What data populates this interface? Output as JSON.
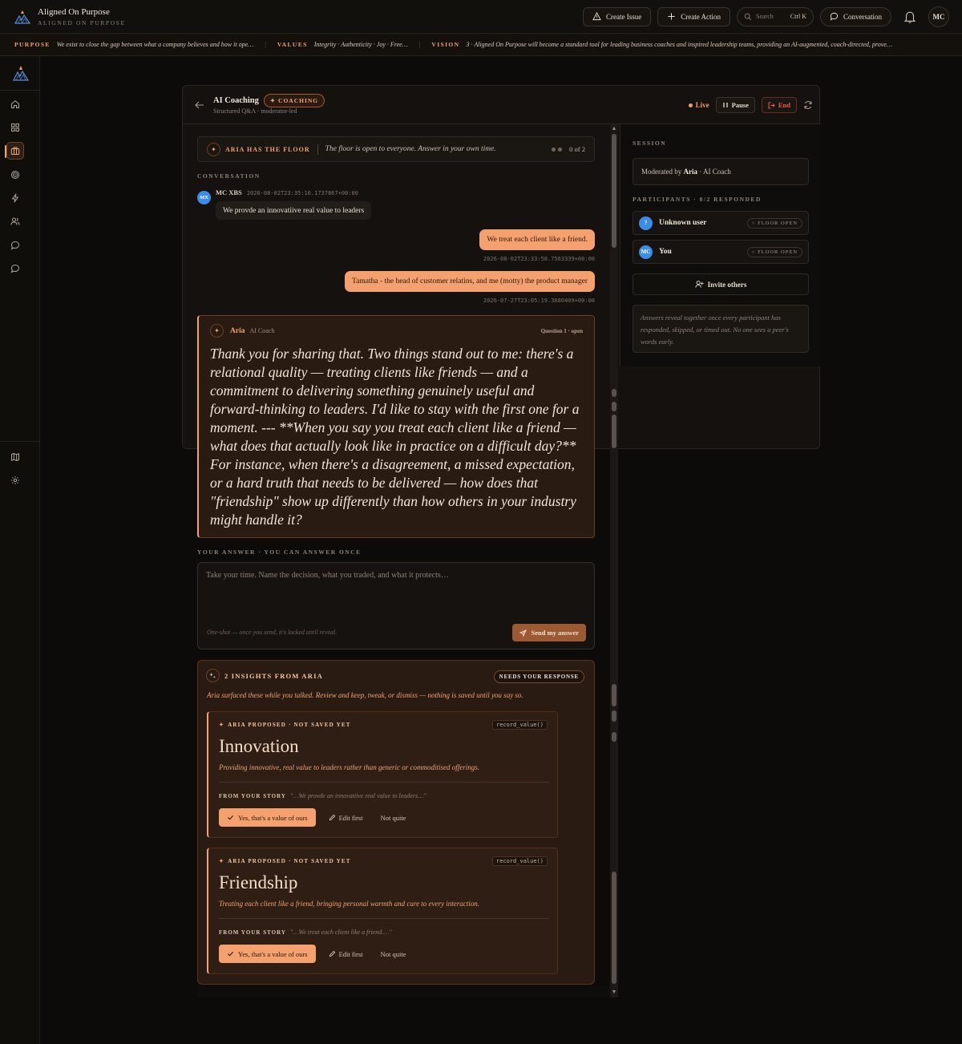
{
  "app": {
    "name": "Aligned On Purpose",
    "subtitle": "ALIGNED ON PURPOSE"
  },
  "topbar": {
    "create_issue": "Create Issue",
    "create_action": "Create Action",
    "search_placeholder": "Search",
    "search_shortcut": "Ctrl K",
    "conversation": "Conversation",
    "user_initials": "MC"
  },
  "ribbon": {
    "purpose_label": "PURPOSE",
    "purpose_text": "We exist to close the gap between what a company believes and how it ope…",
    "values_label": "VALUES",
    "values_text": "Integrity · Authenticity · Joy · Free…",
    "vision_label": "VISION",
    "vision_text": "3 · Aligned On Purpose will become a standard tool for leading business coaches and inspired leadership teams, providing an AI-augmented, coach-directed, prove…"
  },
  "session_header": {
    "title": "AI Coaching",
    "badge": "✦ COACHING",
    "subtitle": "Structured Q&A · moderator-led",
    "live": "Live",
    "pause": "Pause",
    "end": "End"
  },
  "floor": {
    "label": "ARIA HAS THE FLOOR",
    "text": "The floor is open to everyone. Answer in your own time.",
    "count": "0 of 2"
  },
  "conversation": {
    "label": "CONVERSATION",
    "messages": [
      {
        "initials": "MX",
        "author": "MC XBS",
        "timestamp": "2026-08-02T23:35:10.1737867+00:00",
        "text": "We provde an innovatiive real value to leaders"
      },
      {
        "text": "We treat each client like a friend.",
        "timestamp": "2026-08-02T23:33:58.7563339+00:00"
      },
      {
        "text": "Tamatha - the head of customer relatins, and me (motty) the product manager",
        "timestamp": "2026-07-27T23:05:19.3680409+00:00"
      }
    ]
  },
  "aria_question": {
    "name": "Aria",
    "role": "AI Coach",
    "label": "Question 1 · open",
    "text": "Thank you for sharing that. Two things stand out to me: there's a relational quality — treating clients like friends — and a commitment to delivering something genuinely useful and forward-thinking to leaders. I'd like to stay with the first one for a moment. --- **When you say you treat each client like a friend — what does that actually look like in practice on a difficult day?** For instance, when there's a disagreement, a missed expectation, or a hard truth that needs to be delivered — how does that \"friendship\" show up differently than how others in your industry might handle it?"
  },
  "answer": {
    "label": "YOUR ANSWER · YOU CAN ANSWER ONCE",
    "placeholder": "Take your time. Name the decision, what you traded, and what it protects…",
    "hint": "One-shot — once you send, it's locked until reveal.",
    "send": "Send my answer"
  },
  "insights": {
    "title": "2 INSIGHTS FROM ARIA",
    "badge": "NEEDS YOUR RESPONSE",
    "subtitle": "Aria surfaced these while you talked. Review and keep, tweak, or dismiss — nothing is saved until you say so.",
    "items": [
      {
        "label": "ARIA PROPOSED · NOT SAVED YET",
        "fn": "record_value()",
        "title": "Innovation",
        "desc": "Providing innovative, real value to leaders rather than generic or commoditised offerings.",
        "story_label": "FROM YOUR STORY",
        "story": "\"…We provde an innovatiive real value to leaders…\"",
        "yes": "Yes, that's a value of ours",
        "edit": "Edit first",
        "no": "Not quite"
      },
      {
        "label": "ARIA PROPOSED · NOT SAVED YET",
        "fn": "record_value()",
        "title": "Friendship",
        "desc": "Treating each client like a friend, bringing personal warmth and care to every interaction.",
        "story_label": "FROM YOUR STORY",
        "story": "\"…We treat each client like a friend.…\"",
        "yes": "Yes, that's a value of ours",
        "edit": "Edit first",
        "no": "Not quite"
      }
    ]
  },
  "session_panel": {
    "label": "SESSION",
    "moderated_prefix": "Moderated by",
    "moderator": "Aria",
    "moderator_role": "· AI Coach",
    "participants_label": "PARTICIPANTS · 0/2 RESPONDED",
    "participants": [
      {
        "initials": "?",
        "name": "Unknown user",
        "status": "○ FLOOR OPEN"
      },
      {
        "initials": "MC",
        "name": "You",
        "status": "○ FLOOR OPEN"
      }
    ],
    "invite": "Invite others",
    "note": "Answers reveal together once every participant has responded, skipped, or timed out. No one sees a peer's words early."
  },
  "colors": {
    "accent": "#f4a06f",
    "live": "#f29c68",
    "end": "#ef5b46",
    "avatar_blue": "#3a8eea"
  }
}
